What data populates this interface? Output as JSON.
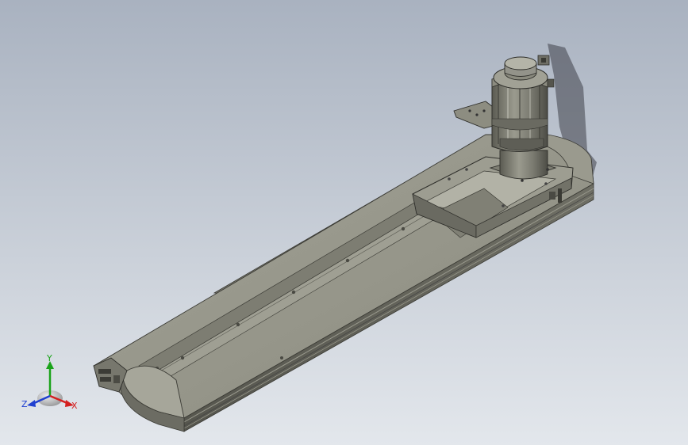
{
  "viewport": {
    "background_top": "#a9b2c0",
    "background_bottom": "#e3e7ec",
    "model_color": "#8f8f82",
    "model_dark": "#5e5e55",
    "model_light": "#b4b4a8"
  },
  "triad": {
    "x_label": "X",
    "y_label": "Y",
    "z_label": "Z",
    "x_color": "#d42020",
    "y_color": "#1aa31a",
    "z_color": "#2040d0"
  }
}
